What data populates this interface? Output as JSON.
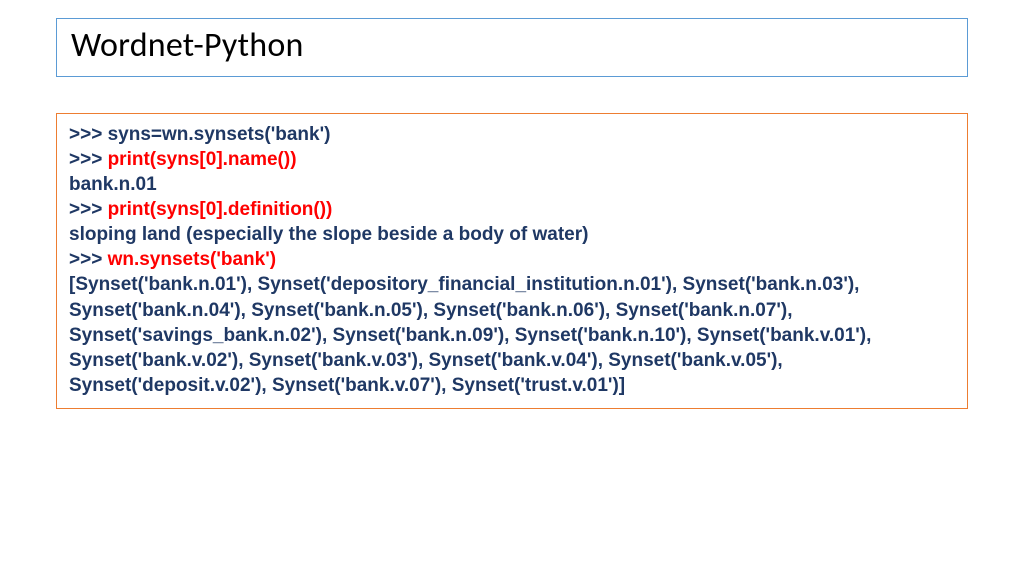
{
  "title": "Wordnet-Python",
  "code": {
    "line1_prompt": ">>> ",
    "line1_cmd": "syns=wn.synsets('bank')",
    "line2_prompt": ">>> ",
    "line2_cmd": "print(syns[0].name())",
    "line3_out": "bank.n.01",
    "line4_prompt": ">>> ",
    "line4_cmd": "print(syns[0].definition())",
    "line5_out": "sloping land (especially the slope beside a body of water)",
    "line6_prompt": ">>> ",
    "line6_cmd": "wn.synsets('bank')",
    "line7_out": "[Synset('bank.n.01'), Synset('depository_financial_institution.n.01'), Synset('bank.n.03'), Synset('bank.n.04'), Synset('bank.n.05'), Synset('bank.n.06'), Synset('bank.n.07'), Synset('savings_bank.n.02'), Synset('bank.n.09'), Synset('bank.n.10'), Synset('bank.v.01'), Synset('bank.v.02'), Synset('bank.v.03'), Synset('bank.v.04'), Synset('bank.v.05'), Synset('deposit.v.02'), Synset('bank.v.07'), Synset('trust.v.01')]"
  }
}
